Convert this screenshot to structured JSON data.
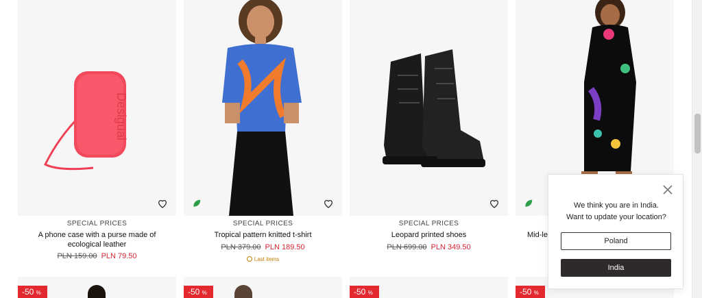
{
  "products": [
    {
      "category": "SPECIAL PRICES",
      "name": "A phone case with a purse made of ecological leather",
      "old_price": "PLN 159.00",
      "new_price": "PLN 79.50",
      "icon": "phone-purse-image"
    },
    {
      "category": "SPECIAL PRICES",
      "name": "Tropical pattern knitted t-shirt",
      "old_price": "PLN 379.00",
      "new_price": "PLN 189.50",
      "stock": "Last items",
      "icon": "model-tshirt-image"
    },
    {
      "category": "SPECIAL PRICES",
      "name": "Leopard printed shoes",
      "old_price": "PLN 699.00",
      "new_price": "PLN 349.50",
      "icon": "boots-image"
    },
    {
      "category": "",
      "name": "Mid-le",
      "old_price": "",
      "new_price": "",
      "icon": "model-dress-image"
    }
  ],
  "discount_badges": [
    "-50",
    "-50",
    "-50",
    "-50"
  ],
  "discount_unit": "%",
  "location_popup": {
    "message_line1": "We think you are in India.",
    "message_line2": "Want to update your location?",
    "option_1": "Poland",
    "option_2": "India"
  },
  "colors": {
    "sale": "#d82436",
    "badge": "#e3282f",
    "eco": "#2e9e4a",
    "primary_button": "#2d2a29"
  }
}
